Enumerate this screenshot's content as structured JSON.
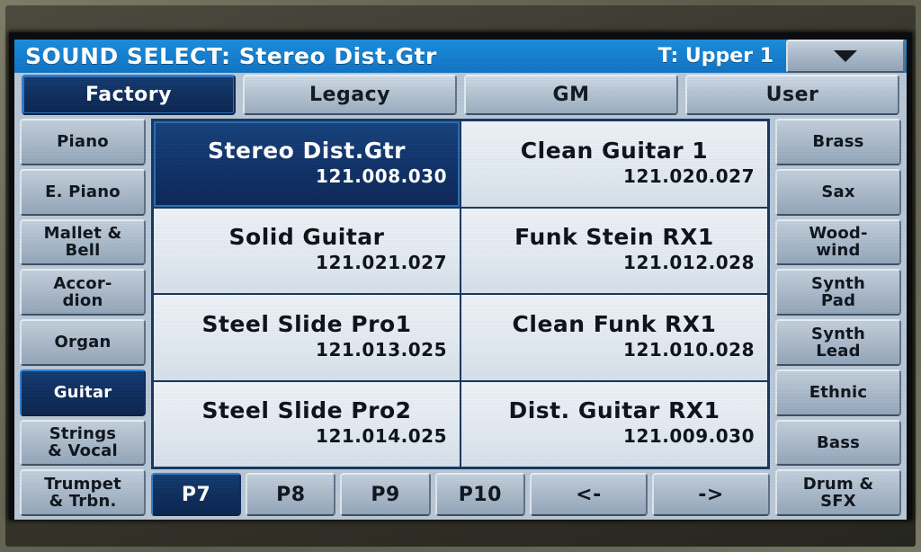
{
  "titlebar": {
    "title": "SOUND SELECT: Stereo Dist.Gtr",
    "track": "T: Upper 1",
    "menu_icon": "chevron-down-icon"
  },
  "tabs": [
    {
      "label": "Factory",
      "selected": true
    },
    {
      "label": "Legacy",
      "selected": false
    },
    {
      "label": "GM",
      "selected": false
    },
    {
      "label": "User",
      "selected": false
    }
  ],
  "left_categories": [
    {
      "label": "Piano",
      "selected": false
    },
    {
      "label": "E. Piano",
      "selected": false
    },
    {
      "label": "Mallet &\nBell",
      "selected": false
    },
    {
      "label": "Accor-\ndion",
      "selected": false
    },
    {
      "label": "Organ",
      "selected": false
    },
    {
      "label": "Guitar",
      "selected": true
    },
    {
      "label": "Strings\n& Vocal",
      "selected": false
    },
    {
      "label": "Trumpet\n& Trbn.",
      "selected": false
    }
  ],
  "right_categories": [
    {
      "label": "Brass",
      "selected": false
    },
    {
      "label": "Sax",
      "selected": false
    },
    {
      "label": "Wood-\nwind",
      "selected": false
    },
    {
      "label": "Synth\nPad",
      "selected": false
    },
    {
      "label": "Synth\nLead",
      "selected": false
    },
    {
      "label": "Ethnic",
      "selected": false
    },
    {
      "label": "Bass",
      "selected": false
    },
    {
      "label": "Drum &\nSFX",
      "selected": false
    }
  ],
  "sound_grid": {
    "rows": [
      [
        {
          "name": "Stereo Dist.Gtr",
          "number": "121.008.030",
          "selected": true
        },
        {
          "name": "Clean Guitar 1",
          "number": "121.020.027",
          "selected": false
        }
      ],
      [
        {
          "name": "Solid Guitar",
          "number": "121.021.027",
          "selected": false
        },
        {
          "name": "Funk Stein RX1",
          "number": "121.012.028",
          "selected": false
        }
      ],
      [
        {
          "name": "Steel Slide Pro1",
          "number": "121.013.025",
          "selected": false
        },
        {
          "name": "Clean Funk RX1",
          "number": "121.010.028",
          "selected": false
        }
      ],
      [
        {
          "name": "Steel Slide Pro2",
          "number": "121.014.025",
          "selected": false
        },
        {
          "name": "Dist. Guitar RX1",
          "number": "121.009.030",
          "selected": false
        }
      ]
    ]
  },
  "pages": [
    {
      "label": "P7",
      "selected": true,
      "nav": false
    },
    {
      "label": "P8",
      "selected": false,
      "nav": false
    },
    {
      "label": "P9",
      "selected": false,
      "nav": false
    },
    {
      "label": "P10",
      "selected": false,
      "nav": false
    },
    {
      "label": "<-",
      "selected": false,
      "nav": true
    },
    {
      "label": "->",
      "selected": false,
      "nav": true
    }
  ],
  "colors": {
    "title_blue": "#1380d2",
    "selected_navy": "#0d2d5c",
    "button_face": "#adbccc",
    "cell_face": "#e3eaf2",
    "grid_border": "#16365f",
    "bezel": "#6b6b5a"
  }
}
